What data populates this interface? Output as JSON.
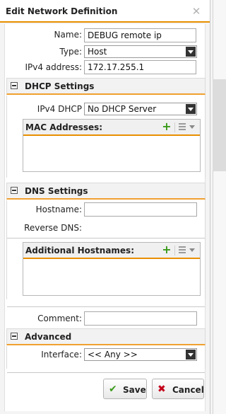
{
  "dialog": {
    "title": "Edit Network Definition"
  },
  "form": {
    "name_label": "Name:",
    "name_value": "DEBUG remote ip",
    "type_label": "Type:",
    "type_value": "Host",
    "ipv4_label": "IPv4 address:",
    "ipv4_value": "172.17.255.1"
  },
  "dhcp": {
    "title": "DHCP Settings",
    "ipv4_dhcp_label": "IPv4 DHCP",
    "ipv4_dhcp_value": "No DHCP Server",
    "mac_title": "MAC Addresses:"
  },
  "dns": {
    "title": "DNS Settings",
    "hostname_label": "Hostname:",
    "hostname_value": "",
    "reverse_label": "Reverse DNS:",
    "additional_title": "Additional Hostnames:"
  },
  "comment": {
    "label": "Comment:",
    "value": ""
  },
  "advanced": {
    "title": "Advanced",
    "interface_label": "Interface:",
    "interface_value": "<< Any >>"
  },
  "buttons": {
    "save": "Save",
    "cancel": "Cancel"
  },
  "colors": {
    "accent": "#e88f00",
    "add_green": "#3a9a1a",
    "cancel_red": "#c4001a"
  }
}
